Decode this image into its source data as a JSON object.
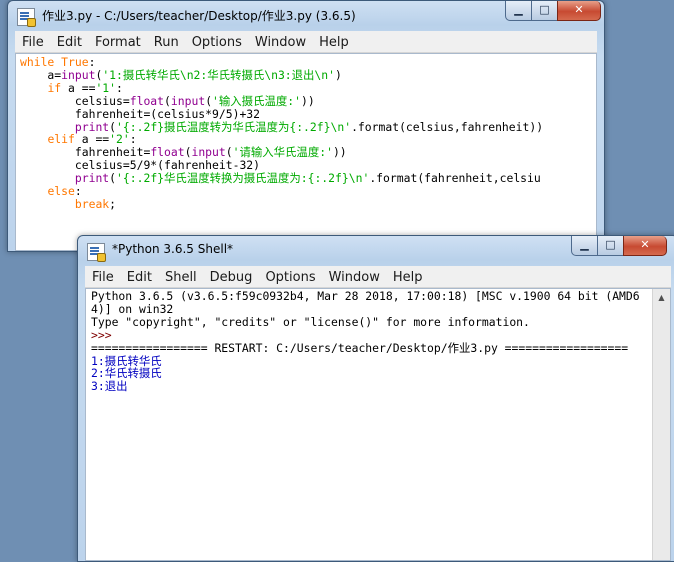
{
  "editor": {
    "title": "作业3.py - C:/Users/teacher/Desktop/作业3.py (3.6.5)",
    "menus": [
      "File",
      "Edit",
      "Format",
      "Run",
      "Options",
      "Window",
      "Help"
    ],
    "code": {
      "l1_kw": "while",
      "l1_true": "True",
      "l1_colon": ":",
      "l2_indent": "    a=",
      "l2_fn": "input",
      "l2_open": "(",
      "l2_str": "'1:摄氏转华氏\\n2:华氏转摄氏\\n3:退出\\n'",
      "l2_close": ")",
      "l3_indent": "    ",
      "l3_kw": "if",
      "l3_rest": " a ==",
      "l3_str": "'1'",
      "l3_colon": ":",
      "l4_indent": "        celsius=",
      "l4_fn1": "float",
      "l4_p1": "(",
      "l4_fn2": "input",
      "l4_p2": "(",
      "l4_str": "'输入摄氏温度:'",
      "l4_close": "))",
      "l5": "        fahrenheit=(celsius*9/5)+32",
      "l6_indent": "        ",
      "l6_fn": "print",
      "l6_open": "(",
      "l6_str": "'{:.2f}摄氏温度转为华氏温度为{:.2f}\\n'",
      "l6_rest": ".format(celsius,fahrenheit))",
      "l7_indent": "    ",
      "l7_kw": "elif",
      "l7_rest": " a ==",
      "l7_str": "'2'",
      "l7_colon": ":",
      "l8_indent": "        fahrenheit=",
      "l8_fn1": "float",
      "l8_p1": "(",
      "l8_fn2": "input",
      "l8_p2": "(",
      "l8_str": "'请输入华氏温度:'",
      "l8_close": "))",
      "l9": "        celsius=5/9*(fahrenheit-32)",
      "l10_indent": "        ",
      "l10_fn": "print",
      "l10_open": "(",
      "l10_str": "'{:.2f}华氏温度转换为摄氏温度为:{:.2f}\\n'",
      "l10_rest": ".format(fahrenheit,celsiu",
      "l11_indent": "    ",
      "l11_kw": "else",
      "l11_colon": ":",
      "l12_indent": "        ",
      "l12_kw": "break",
      "l12_semi": ";"
    }
  },
  "shell": {
    "title": "*Python 3.6.5 Shell*",
    "menus": [
      "File",
      "Edit",
      "Shell",
      "Debug",
      "Options",
      "Window",
      "Help"
    ],
    "lines": {
      "banner1": "Python 3.6.5 (v3.6.5:f59c0932b4, Mar 28 2018, 17:00:18) [MSC v.1900 64 bit (AMD6",
      "banner2": "4)] on win32",
      "banner3": "Type \"copyright\", \"credits\" or \"license()\" for more information.",
      "prompt": ">>> ",
      "restart": "================= RESTART: C:/Users/teacher/Desktop/作业3.py ==================",
      "out1": "1:摄氏转华氏",
      "out2": "2:华氏转摄氏",
      "out3": "3:退出"
    }
  },
  "icons": {
    "minimize": "minimize-icon",
    "maximize": "maximize-icon",
    "close": "close-icon"
  }
}
